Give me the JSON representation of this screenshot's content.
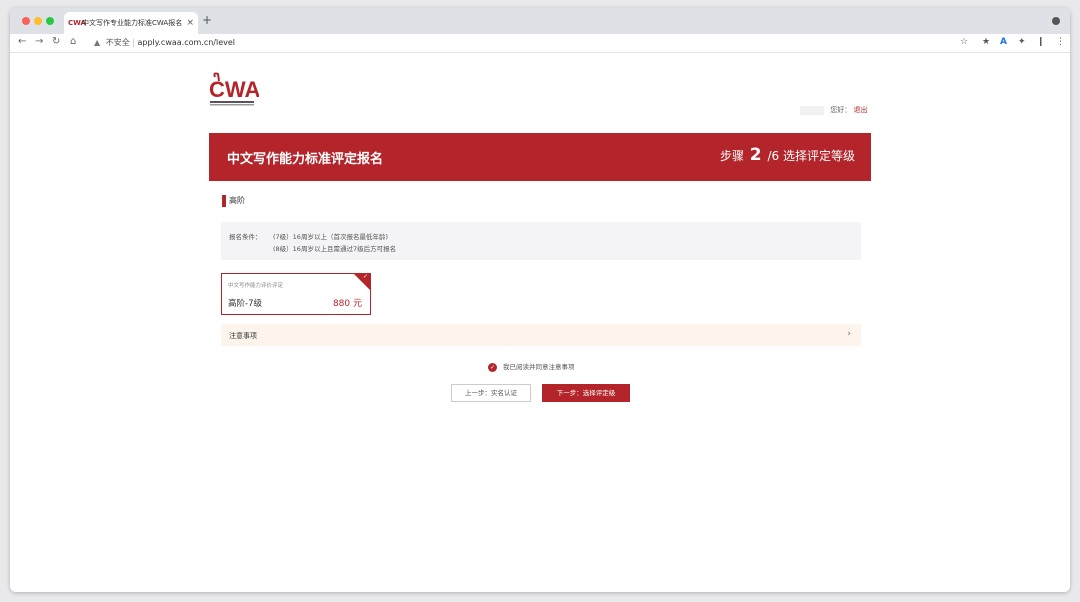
{
  "browser": {
    "tab_title": "中文写作专业能力标准CWA报名",
    "tab_favicon": "CWA",
    "address_warning": "不安全",
    "address_url": "apply.cwaa.com.cn/level"
  },
  "header": {
    "logo_text": "CWA",
    "greeting": "您好",
    "logout": "退出"
  },
  "banner": {
    "title": "中文写作能力标准评定报名",
    "step_prefix": "步骤",
    "step_current": "2",
    "step_total": "/6",
    "step_name": "选择评定等级"
  },
  "section": {
    "title": "高阶"
  },
  "conditions": {
    "label": "报名条件：",
    "line1": "(7级）16周岁以上（首次报名最低年龄)",
    "line2": "(8级）16周岁以上且需通过7级后方可报名"
  },
  "level_card": {
    "subtitle": "中文写作能力评价评定",
    "name": "高阶-7级",
    "price": "880 元",
    "selected": true
  },
  "notes": {
    "label": "注意事项"
  },
  "agree": {
    "text": "我已阅读并同意注意事项",
    "checked": true
  },
  "buttons": {
    "prev": "上一步：实名认证",
    "next": "下一步：选择评定级"
  },
  "colors": {
    "brand_red": "#b3252b",
    "notes_bg": "#fdf5ec",
    "conditions_bg": "#f4f4f6"
  },
  "icons": {
    "back": "arrow-left-icon",
    "forward": "arrow-right-icon",
    "reload": "reload-icon",
    "home": "home-icon",
    "warning": "warning-icon",
    "star": "star-icon",
    "check": "check-icon",
    "chevron": "chevron-right-icon"
  }
}
